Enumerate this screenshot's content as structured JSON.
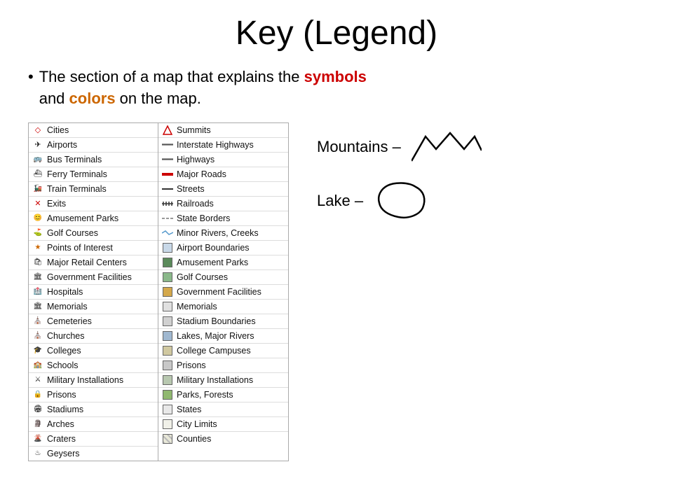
{
  "title": "Key (Legend)",
  "intro": {
    "bullet": "•",
    "text_before": "The section of a map that explains the ",
    "symbols_word": "symbols",
    "text_middle": " and ",
    "colors_word": "colors",
    "text_after": " on the map."
  },
  "left_col_items": [
    {
      "icon": "◇",
      "label": "Cities"
    },
    {
      "icon": "✈",
      "label": "Airports"
    },
    {
      "icon": "🚌",
      "label": "Bus Terminals"
    },
    {
      "icon": "⛴",
      "label": "Ferry Terminals"
    },
    {
      "icon": "🚂",
      "label": "Train Terminals"
    },
    {
      "icon": "✕",
      "label": "Exits"
    },
    {
      "icon": "😊",
      "label": "Amusement Parks"
    },
    {
      "icon": "⛳",
      "label": "Golf Courses"
    },
    {
      "icon": "★",
      "label": "Points of Interest"
    },
    {
      "icon": "🛍",
      "label": "Major Retail Centers"
    },
    {
      "icon": "🏛",
      "label": "Government Facilities"
    },
    {
      "icon": "🏥",
      "label": "Hospitals"
    },
    {
      "icon": "🏛",
      "label": "Memorials"
    },
    {
      "icon": "⛪",
      "label": "Cemeteries"
    },
    {
      "icon": "⛪",
      "label": "Churches"
    },
    {
      "icon": "🎓",
      "label": "Colleges"
    },
    {
      "icon": "🏫",
      "label": "Schools"
    },
    {
      "icon": "⚔",
      "label": "Military Installations"
    },
    {
      "icon": "🔒",
      "label": "Prisons"
    },
    {
      "icon": "🏟",
      "label": "Stadiums"
    },
    {
      "icon": "🗿",
      "label": "Arches"
    },
    {
      "icon": "🌋",
      "label": "Craters"
    },
    {
      "icon": "♨",
      "label": "Geysers"
    }
  ],
  "right_col_items": [
    {
      "icon": "▲",
      "label": "Summits",
      "color": null
    },
    {
      "icon": "road",
      "label": "Interstate Highways",
      "color": null
    },
    {
      "icon": "road",
      "label": "Highways",
      "color": null
    },
    {
      "icon": "road_red",
      "label": "Major Roads",
      "color": null
    },
    {
      "icon": "road_thin",
      "label": "Streets",
      "color": null
    },
    {
      "icon": "road_rail",
      "label": "Railroads",
      "color": null
    },
    {
      "icon": "border",
      "label": "State Borders",
      "color": null
    },
    {
      "icon": "river",
      "label": "Minor Rivers, Creeks",
      "color": null
    },
    {
      "icon": "box",
      "label": "Airport Boundaries",
      "color": "#c8d8e8"
    },
    {
      "icon": "box",
      "label": "Amusement Parks",
      "color": "#5a8a5a"
    },
    {
      "icon": "box",
      "label": "Golf Courses",
      "color": "#8ab88a"
    },
    {
      "icon": "box",
      "label": "Government Facilities",
      "color": "#d4a84b"
    },
    {
      "icon": "box",
      "label": "Memorials",
      "color": "#e0e0e0"
    },
    {
      "icon": "box",
      "label": "Stadium Boundaries",
      "color": "#d0d0d0"
    },
    {
      "icon": "box",
      "label": "Lakes, Major Rivers",
      "color": "#a0b8d0"
    },
    {
      "icon": "box",
      "label": "College Campuses",
      "color": "#d0c8a0"
    },
    {
      "icon": "box",
      "label": "Prisons",
      "color": "#c8c8c8"
    },
    {
      "icon": "box",
      "label": "Military Installations",
      "color": "#b8c8b0"
    },
    {
      "icon": "box",
      "label": "Parks, Forests",
      "color": "#90b870"
    },
    {
      "icon": "box",
      "label": "States",
      "color": "#e8e8e8"
    },
    {
      "icon": "box",
      "label": "City Limits",
      "color": "#f0f0e8"
    },
    {
      "icon": "box_hatch",
      "label": "Counties",
      "color": "#e8e8d8"
    }
  ],
  "mountains_label": "Mountains –",
  "lake_label": "Lake –"
}
